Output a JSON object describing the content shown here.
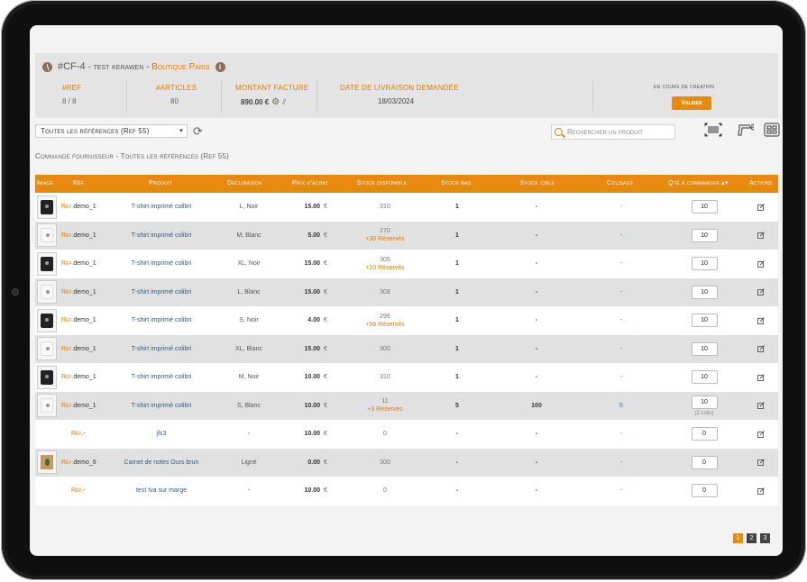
{
  "order": {
    "id": "#CF-4",
    "name": "test kerawen",
    "separator": "-",
    "shop": "Boutique Paris"
  },
  "stats": [
    {
      "label": "#REF",
      "value": "8 / 8"
    },
    {
      "label": "#ARTICLES",
      "value": "80"
    },
    {
      "label": "MONTANT FACTURE",
      "value": "890.00 €"
    },
    {
      "label": "DATE DE LIVRAISON DEMANDÉE",
      "value": "18/03/2024"
    }
  ],
  "status": {
    "text": "en cours de création",
    "button": "Valider"
  },
  "toolbar": {
    "select_value": "Toutes les références (Ref 55)",
    "search_placeholder": "Rechercher un produit"
  },
  "section_title": "Commande fournisseur - Toutes les références (Ref 55)",
  "table": {
    "headers": {
      "image": "Image",
      "ref": "Réf.",
      "product": "Produit",
      "decl": "Déclinaison",
      "price": "Prix d'achat",
      "stock": "Stock disponible",
      "stock_low": "Stock bas",
      "stock_target": "Stock cible",
      "pack": "Colisage",
      "qty": "Qté à commander ▴▾",
      "actions": "Actions"
    },
    "rows": [
      {
        "img": "noir",
        "ref_prefix": "Réf.",
        "ref": "demo_1",
        "product": "T-shirt imprimé colibri",
        "decl": "L, Noir",
        "price": "15.00",
        "currency": "€",
        "stock": "310",
        "reserved": "",
        "stock_low": "1",
        "stock_target": "-",
        "pack": "-",
        "qty": "10",
        "qty_note": ""
      },
      {
        "img": "blanc",
        "ref_prefix": "Réf.",
        "ref": "demo_1",
        "product": "T-shirt imprimé colibri",
        "decl": "M, Blanc",
        "price": "5.00",
        "currency": "€",
        "stock": "270",
        "reserved": "+30 Réservés",
        "stock_low": "1",
        "stock_target": "-",
        "pack": "-",
        "qty": "10",
        "qty_note": ""
      },
      {
        "img": "noir",
        "ref_prefix": "Réf.",
        "ref": "demo_1",
        "product": "T-shirt imprimé colibri",
        "decl": "XL, Noir",
        "price": "15.00",
        "currency": "€",
        "stock": "305",
        "reserved": "+10 Réservés",
        "stock_low": "1",
        "stock_target": "-",
        "pack": "-",
        "qty": "10",
        "qty_note": ""
      },
      {
        "img": "blanc",
        "ref_prefix": "Réf.",
        "ref": "demo_1",
        "product": "T-shirt imprimé colibri",
        "decl": "L, Blanc",
        "price": "15.00",
        "currency": "€",
        "stock": "308",
        "reserved": "",
        "stock_low": "1",
        "stock_target": "-",
        "pack": "-",
        "qty": "10",
        "qty_note": ""
      },
      {
        "img": "noir",
        "ref_prefix": "Réf.",
        "ref": "demo_1",
        "product": "T-shirt imprimé colibri",
        "decl": "S, Noir",
        "price": "4.00",
        "currency": "€",
        "stock": "296",
        "reserved": "+56 Réservés",
        "stock_low": "1",
        "stock_target": "-",
        "pack": "-",
        "qty": "10",
        "qty_note": ""
      },
      {
        "img": "blanc",
        "ref_prefix": "Réf.",
        "ref": "demo_1",
        "product": "T-shirt imprimé colibri",
        "decl": "XL, Blanc",
        "price": "15.00",
        "currency": "€",
        "stock": "300",
        "reserved": "",
        "stock_low": "1",
        "stock_target": "-",
        "pack": "-",
        "qty": "10",
        "qty_note": ""
      },
      {
        "img": "noir",
        "ref_prefix": "Réf.",
        "ref": "demo_1",
        "product": "T-shirt imprimé colibri",
        "decl": "M, Noir",
        "price": "10.00",
        "currency": "€",
        "stock": "310",
        "reserved": "",
        "stock_low": "1",
        "stock_target": "-",
        "pack": "-",
        "qty": "10",
        "qty_note": ""
      },
      {
        "img": "blanc",
        "ref_prefix": "Réf.",
        "ref": "demo_1",
        "product": "T-shirt imprimé colibri",
        "decl": "S, Blanc",
        "price": "10.00",
        "currency": "€",
        "stock": "11",
        "reserved": "+3 Réservés",
        "stock_low": "5",
        "stock_target": "100",
        "pack": "6",
        "qty": "10",
        "qty_note": "(2 colis)"
      },
      {
        "img": "",
        "ref_prefix": "Réf.",
        "ref": "-",
        "product": "jfs3",
        "decl": "-",
        "price": "10.00",
        "currency": "€",
        "stock": "0",
        "reserved": "",
        "stock_low": "-",
        "stock_target": "-",
        "pack": "-",
        "qty": "0",
        "qty_note": ""
      },
      {
        "img": "notebook",
        "ref_prefix": "Réf.",
        "ref": "demo_9",
        "product": "Carnet de notes Ours brun",
        "decl": "Ligné",
        "price": "0.00",
        "currency": "€",
        "stock": "300",
        "reserved": "",
        "stock_low": "-",
        "stock_target": "-",
        "pack": "-",
        "qty": "0",
        "qty_note": ""
      },
      {
        "img": "",
        "ref_prefix": "Réf.",
        "ref": "-",
        "product": "test tva sur marge",
        "decl": "-",
        "price": "10.00",
        "currency": "€",
        "stock": "0",
        "reserved": "",
        "stock_low": "-",
        "stock_target": "-",
        "pack": "-",
        "qty": "0",
        "qty_note": ""
      }
    ]
  },
  "pagination": {
    "pages": [
      "1",
      "2",
      "3"
    ],
    "current": "1"
  },
  "icons": {
    "history": "clock-icon",
    "info": "info-icon",
    "settings": "gear-icon",
    "attachment": "paperclip-icon",
    "refresh": "refresh-icon",
    "search": "search-icon",
    "barcode": "barcode-icon",
    "scanner": "scanner-icon",
    "grid": "grid-icon",
    "edit": "edit-icon"
  },
  "colors": {
    "accent": "#e98a10",
    "link": "#2f5e7a",
    "pack_link": "#2a88b8"
  }
}
